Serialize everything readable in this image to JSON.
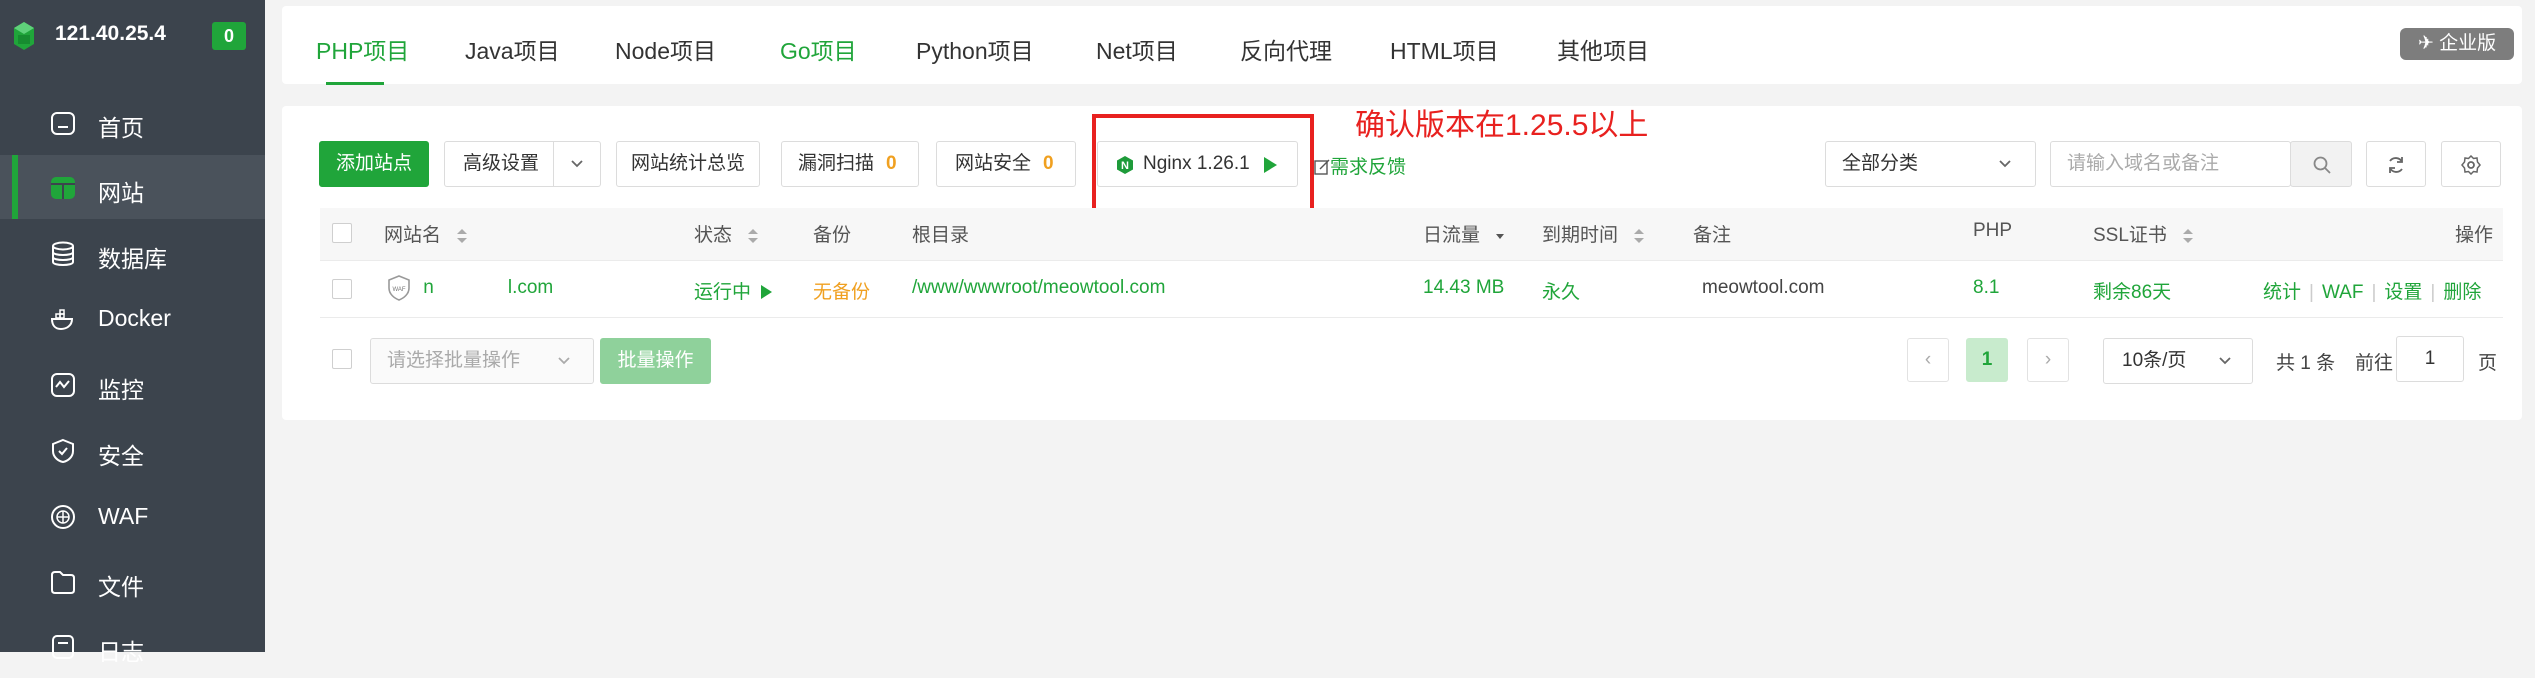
{
  "sidebar": {
    "server_ip": "121.40.25.4",
    "badge_count": "0",
    "items": [
      {
        "label": "首页",
        "icon": "home-icon"
      },
      {
        "label": "网站",
        "icon": "website-icon",
        "active": true
      },
      {
        "label": "数据库",
        "icon": "database-icon"
      },
      {
        "label": "Docker",
        "icon": "docker-icon"
      },
      {
        "label": "监控",
        "icon": "monitor-icon"
      },
      {
        "label": "安全",
        "icon": "shield-icon"
      },
      {
        "label": "WAF",
        "icon": "waf-icon"
      },
      {
        "label": "文件",
        "icon": "folder-icon"
      },
      {
        "label": "日志",
        "icon": "log-icon"
      }
    ]
  },
  "tabs": [
    "PHP项目",
    "Java项目",
    "Node项目",
    "Go项目",
    "Python项目",
    "Net项目",
    "反向代理",
    "HTML项目",
    "其他项目"
  ],
  "enterprise_label": "企业版",
  "toolbar": {
    "add_site": "添加站点",
    "advanced": "高级设置",
    "stats_overview": "网站统计总览",
    "vuln_scan": "漏洞扫描",
    "vuln_count": "0",
    "site_security": "网站安全",
    "security_count": "0",
    "nginx": "Nginx 1.26.1",
    "feedback": "需求反馈",
    "category": "全部分类",
    "search_placeholder": "请输入域名或备注"
  },
  "annotation": "确认版本在1.25.5以上",
  "table": {
    "headers": {
      "name": "网站名",
      "status": "状态",
      "backup": "备份",
      "root": "根目录",
      "traffic": "日流量",
      "expiry": "到期时间",
      "note": "备注",
      "php": "PHP",
      "ssl": "SSL证书",
      "ops": "操作"
    },
    "rows": [
      {
        "name_prefix": "n",
        "name_suffix": "l.com",
        "status": "运行中",
        "backup": "无备份",
        "root": "/www/wwwroot/meowtool.com",
        "traffic": "14.43 MB",
        "expiry": "永久",
        "note": "meowtool.com",
        "php": "8.1",
        "ssl": "剩余86天",
        "actions": [
          "统计",
          "WAF",
          "设置",
          "删除"
        ]
      }
    ]
  },
  "footer": {
    "batch_placeholder": "请选择批量操作",
    "batch_button": "批量操作",
    "current_page": "1",
    "per_page": "10条/页",
    "total": "共 1 条",
    "goto": "前往",
    "page_input": "1",
    "page_unit": "页"
  },
  "colors": {
    "accent": "#20a53a",
    "sidebar_bg": "#3c444d",
    "warning": "#f0a020",
    "annotation": "#e8211f"
  }
}
